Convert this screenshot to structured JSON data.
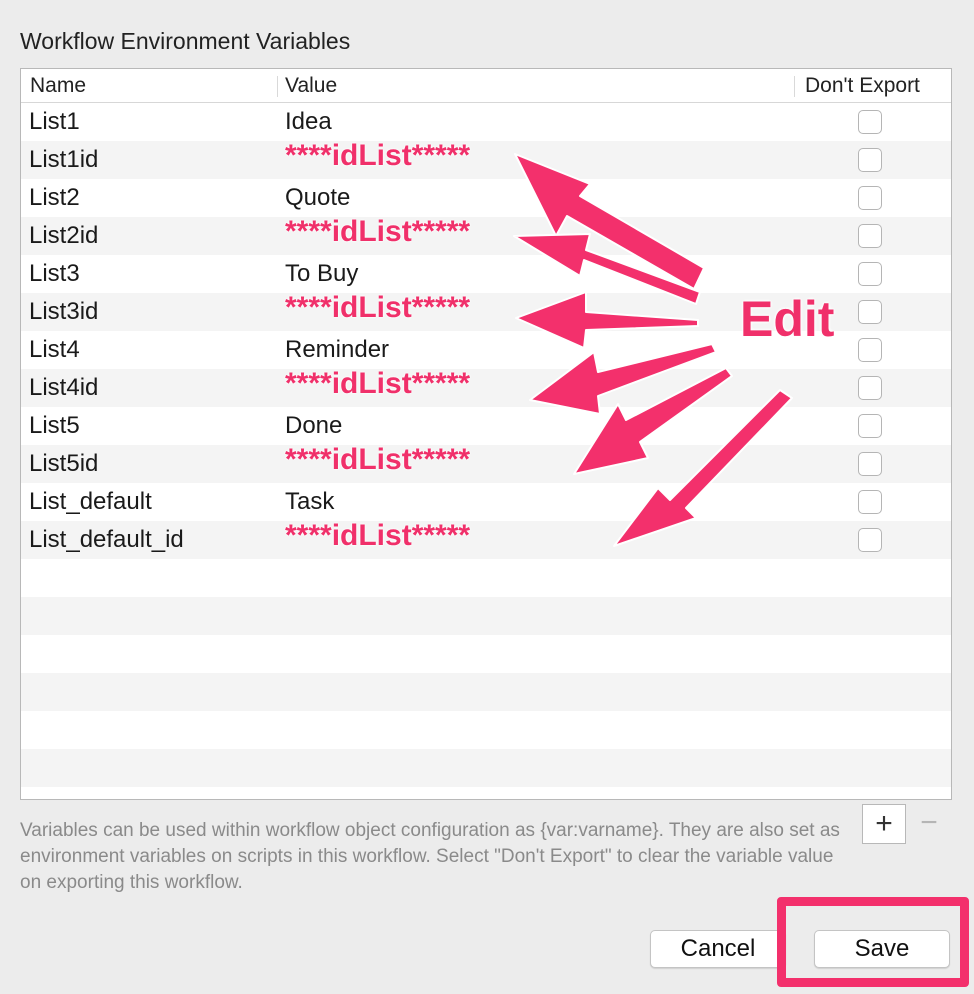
{
  "dialog": {
    "title": "Workflow Environment Variables"
  },
  "table": {
    "columns": {
      "name": "Name",
      "value": "Value",
      "dont_export": "Don't Export"
    },
    "rows": [
      {
        "name": "List1",
        "value": "Idea",
        "masked": false,
        "dont_export": false
      },
      {
        "name": "List1id",
        "value": "****idList*****",
        "masked": true,
        "dont_export": false
      },
      {
        "name": "List2",
        "value": "Quote",
        "masked": false,
        "dont_export": false
      },
      {
        "name": "List2id",
        "value": "****idList*****",
        "masked": true,
        "dont_export": false
      },
      {
        "name": "List3",
        "value": "To Buy",
        "masked": false,
        "dont_export": false
      },
      {
        "name": "List3id",
        "value": "****idList*****",
        "masked": true,
        "dont_export": false
      },
      {
        "name": "List4",
        "value": "Reminder",
        "masked": false,
        "dont_export": false
      },
      {
        "name": "List4id",
        "value": "****idList*****",
        "masked": true,
        "dont_export": false
      },
      {
        "name": "List5",
        "value": "Done",
        "masked": false,
        "dont_export": false
      },
      {
        "name": "List5id",
        "value": "****idList*****",
        "masked": true,
        "dont_export": false
      },
      {
        "name": "List_default",
        "value": "Task",
        "masked": false,
        "dont_export": false
      },
      {
        "name": "List_default_id",
        "value": "****idList*****",
        "masked": true,
        "dont_export": false
      }
    ],
    "empty_rows": 7
  },
  "controls": {
    "add_label": "+",
    "remove_label": "−"
  },
  "help_text": "Variables can be used within workflow object configuration as {var:varname}. They are also set as environment variables on scripts in this workflow. Select \"Don't Export\" to clear the variable value on exporting this workflow.",
  "buttons": {
    "cancel": "Cancel",
    "save": "Save"
  },
  "annotation": {
    "label": "Edit",
    "color": "#f0306a"
  }
}
